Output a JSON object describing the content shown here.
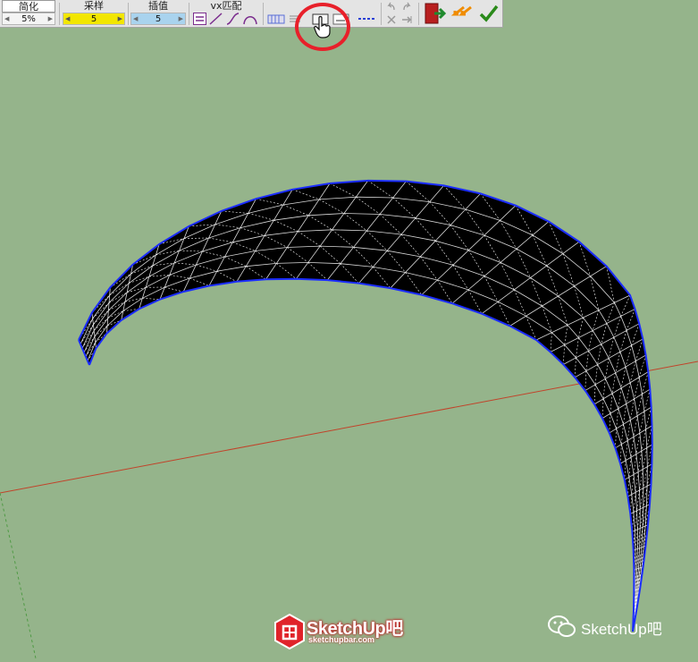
{
  "toolbar": {
    "simplify": {
      "label": "简化",
      "value": "5%"
    },
    "sampling": {
      "label": "采样",
      "value": "5"
    },
    "interpolate": {
      "label": "插值",
      "value": "5"
    },
    "vx_match": {
      "label": "vx匹配"
    },
    "colors": {
      "sampling_field": "#f2e600",
      "interpolate_field": "#a9d3ee",
      "match_icon": "#7b2d8e",
      "grid_icon": "#5a6fd6",
      "accept": "#2a8a1a",
      "undo_orange": "#f08c00"
    },
    "icons": [
      "vx-straight-icon",
      "vx-line-icon",
      "vx-s-curve-icon",
      "vx-arc-icon",
      "grid-columns-icon",
      "grid-rows-icon",
      "selection-pointer-icon",
      "mesh-preview-icon",
      "dashed-line-icon",
      "undo-icon",
      "redo-icon",
      "delete-icon",
      "arrow-right-icon",
      "exit-door-icon",
      "back-orange-icon",
      "accept-check-icon"
    ]
  },
  "watermark": {
    "brand": "SketchUp吧",
    "brand_url": "sketchupbar.com",
    "wechat": "SketchUp吧"
  },
  "scene": {
    "background": "#95b48b",
    "mesh_fill": "#000000",
    "mesh_line": "#d8d8d8",
    "edge": "#1a2cff",
    "axis_red": "#c1432a"
  }
}
